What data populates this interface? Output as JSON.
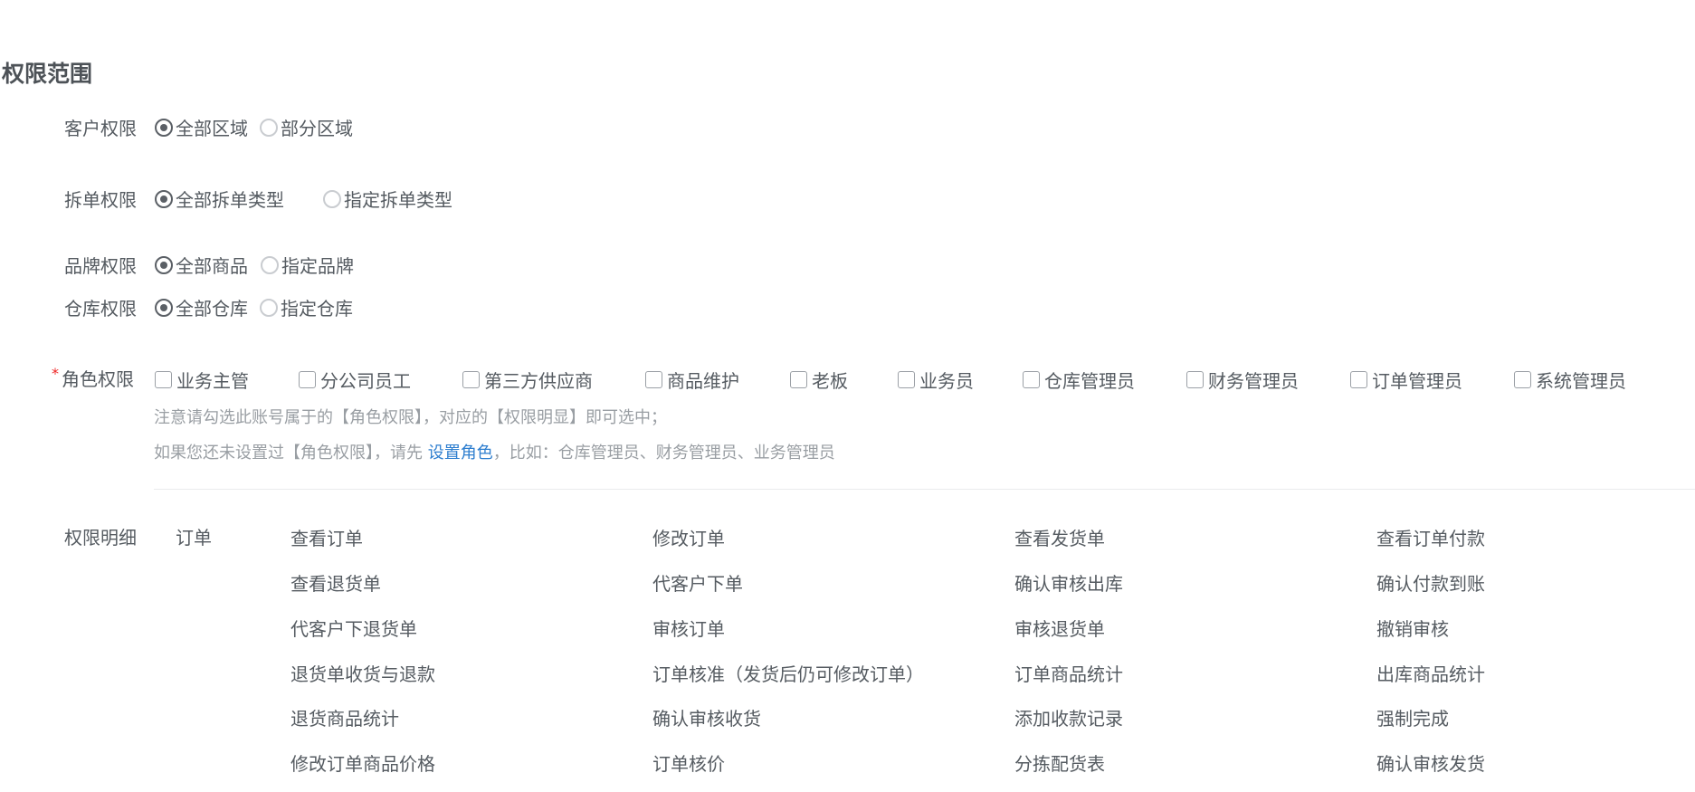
{
  "section_title": "权限范围",
  "customer": {
    "label": "客户权限",
    "options": [
      {
        "label": "全部区域",
        "checked": true
      },
      {
        "label": "部分区域",
        "checked": false
      }
    ]
  },
  "split": {
    "label": "拆单权限",
    "options": [
      {
        "label": "全部拆单类型",
        "checked": true
      },
      {
        "label": "指定拆单类型",
        "checked": false
      }
    ]
  },
  "brand": {
    "label": "品牌权限",
    "options": [
      {
        "label": "全部商品",
        "checked": true
      },
      {
        "label": "指定品牌",
        "checked": false
      }
    ]
  },
  "warehouse": {
    "label": "仓库权限",
    "options": [
      {
        "label": "全部仓库",
        "checked": true
      },
      {
        "label": "指定仓库",
        "checked": false
      }
    ]
  },
  "roles": {
    "required_mark": "*",
    "label": "角色权限",
    "items": [
      "业务主管",
      "分公司员工",
      "第三方供应商",
      "商品维护",
      "老板",
      "业务员",
      "仓库管理员",
      "财务管理员",
      "订单管理员",
      "系统管理员"
    ],
    "hint1": "注意请勾选此账号属于的【角色权限】，对应的【权限明显】即可选中；",
    "hint2_pre": "如果您还未设置过【角色权限】，请先",
    "hint2_link": "设置角色",
    "hint2_post": "，比如：仓库管理员、财务管理员、业务管理员"
  },
  "detail": {
    "label": "权限明细",
    "group": "订单",
    "items": [
      "查看订单",
      "修改订单",
      "查看发货单",
      "查看订单付款",
      "查看退货单",
      "代客户下单",
      "确认审核出库",
      "确认付款到账",
      "代客户下退货单",
      "审核订单",
      "审核退货单",
      "撤销审核",
      "退货单收货与退款",
      "订单核准（发货后仍可修改订单）",
      "订单商品统计",
      "出库商品统计",
      "退货商品统计",
      "确认审核收货",
      "添加收款记录",
      "强制完成",
      "修改订单商品价格",
      "订单核价",
      "分拣配货表",
      "确认审核发货"
    ]
  },
  "colors": {
    "text": "#555b61",
    "hint": "#999ea3",
    "link": "#2d7ecf",
    "required": "#ee2222"
  }
}
